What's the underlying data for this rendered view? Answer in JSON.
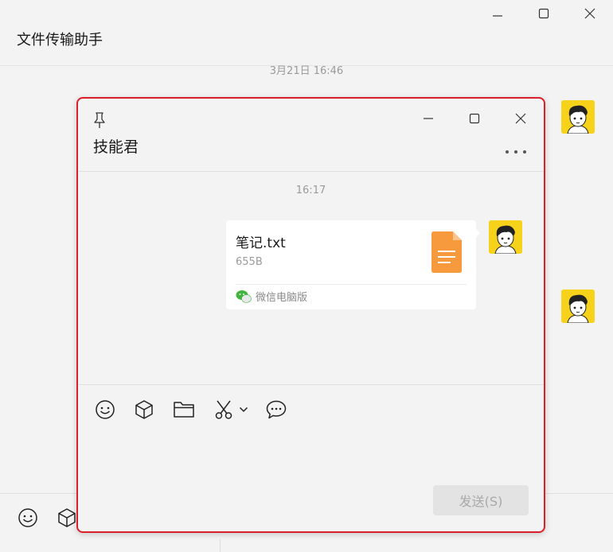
{
  "main_window": {
    "title": "文件传输助手",
    "timestamp": "3月21日 16:46",
    "controls": [
      "minimize-icon",
      "maximize-icon",
      "close-icon"
    ],
    "toolbar_icons": [
      "emoji-icon",
      "cube-icon"
    ]
  },
  "popup": {
    "title": "技能君",
    "controls": [
      "minimize-icon",
      "maximize-icon",
      "close-icon"
    ],
    "timestamp": "16:17",
    "message": {
      "file_name": "笔记.txt",
      "file_size": "655B",
      "source": "微信电脑版"
    },
    "toolbar_icons": [
      "emoji-icon",
      "cube-icon",
      "folder-icon",
      "scissors-icon",
      "chevron-down-icon",
      "chat-bubble-icon"
    ],
    "send_label": "发送(S)"
  },
  "colors": {
    "highlight_border": "#d9202c",
    "avatar_bg": "#f7d21b",
    "file_icon": "#f79a3e",
    "wechat_green": "#3fb53f"
  }
}
